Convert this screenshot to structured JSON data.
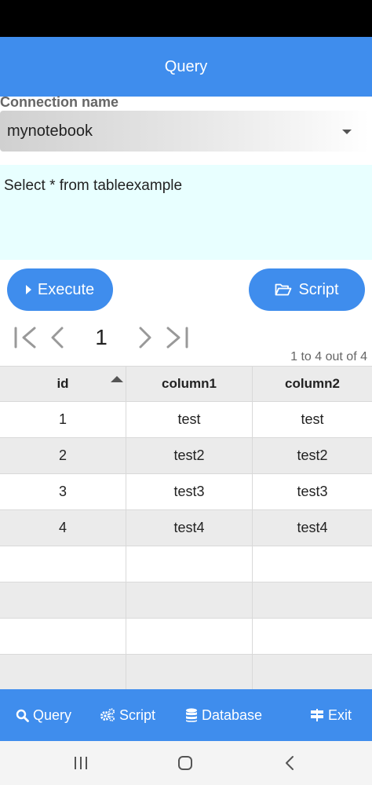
{
  "header": {
    "title": "Query"
  },
  "connection": {
    "label": "Connection name",
    "selected": "mynotebook"
  },
  "query": {
    "text": "Select * from tableexample"
  },
  "buttons": {
    "execute": "Execute",
    "script": "Script"
  },
  "pager": {
    "current_page": "1",
    "records_info": "1 to 4 out of 4"
  },
  "grid": {
    "columns": [
      "id",
      "column1",
      "column2"
    ],
    "sorted_column": "id",
    "rows": [
      [
        "1",
        "test",
        "test"
      ],
      [
        "2",
        "test2",
        "test2"
      ],
      [
        "3",
        "test3",
        "test3"
      ],
      [
        "4",
        "test4",
        "test4"
      ]
    ]
  },
  "bottom_nav": {
    "query": "Query",
    "script": "Script",
    "database": "Database",
    "exit": "Exit"
  },
  "colors": {
    "accent": "#3f8ded",
    "query_bg": "#e8ffff",
    "row_alt": "#ebebeb"
  },
  "icons": [
    "caret-down-icon",
    "play-icon",
    "folder-open-icon",
    "first-page-icon",
    "prev-page-icon",
    "next-page-icon",
    "last-page-icon",
    "sort-asc-icon",
    "search-icon",
    "gears-icon",
    "database-icon",
    "signpost-icon"
  ]
}
